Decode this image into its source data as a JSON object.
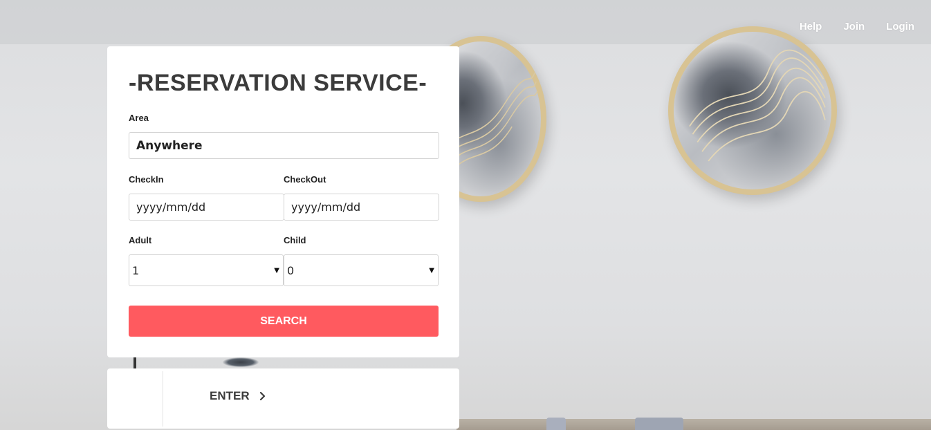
{
  "nav": {
    "help": "Help",
    "join": "Join",
    "login": "Login"
  },
  "reservation": {
    "title": "-RESERVATION SERVICE-",
    "area_label": "Area",
    "area_value": "Anywhere",
    "checkin_label": "CheckIn",
    "checkin_placeholder": "yyyy/mm/dd",
    "checkout_label": "CheckOut",
    "checkout_placeholder": "yyyy/mm/dd",
    "adult_label": "Adult",
    "adult_value": "1",
    "child_label": "Child",
    "child_value": "0",
    "search_label": "SEARCH"
  },
  "enter": {
    "label": "ENTER",
    "icon": "chevron-right-icon"
  },
  "colors": {
    "accent": "#ff5a5f",
    "card_bg": "#ffffff",
    "title_text": "#3b3b3b"
  }
}
